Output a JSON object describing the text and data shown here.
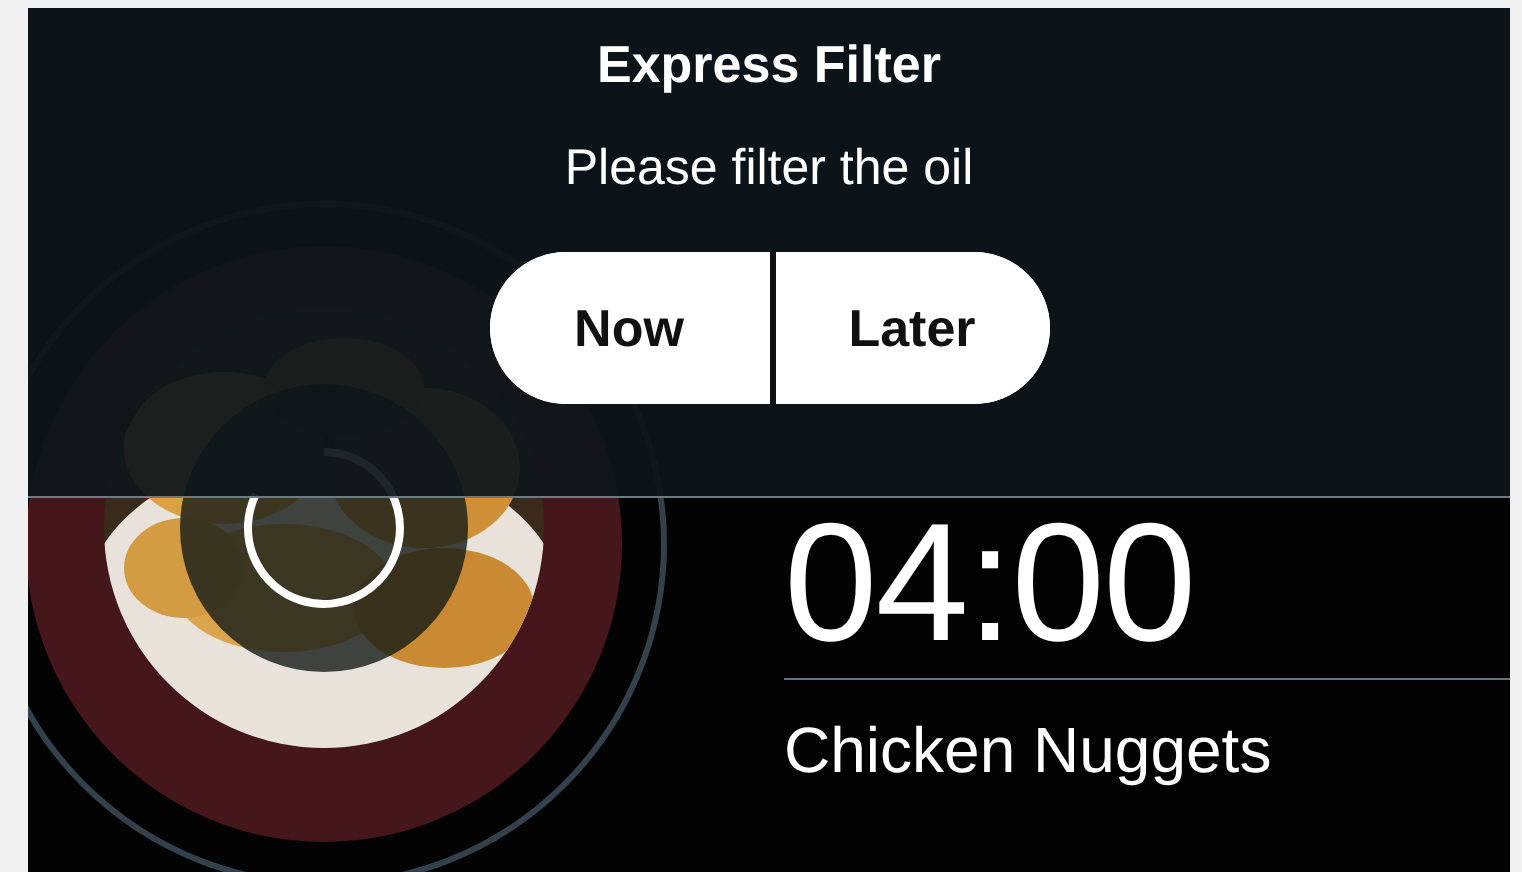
{
  "dialog": {
    "title": "Express Filter",
    "message": "Please filter the oil",
    "buttons": [
      "Now",
      "Later"
    ]
  },
  "timer": "04:00",
  "product_name": "Chicken Nuggets"
}
